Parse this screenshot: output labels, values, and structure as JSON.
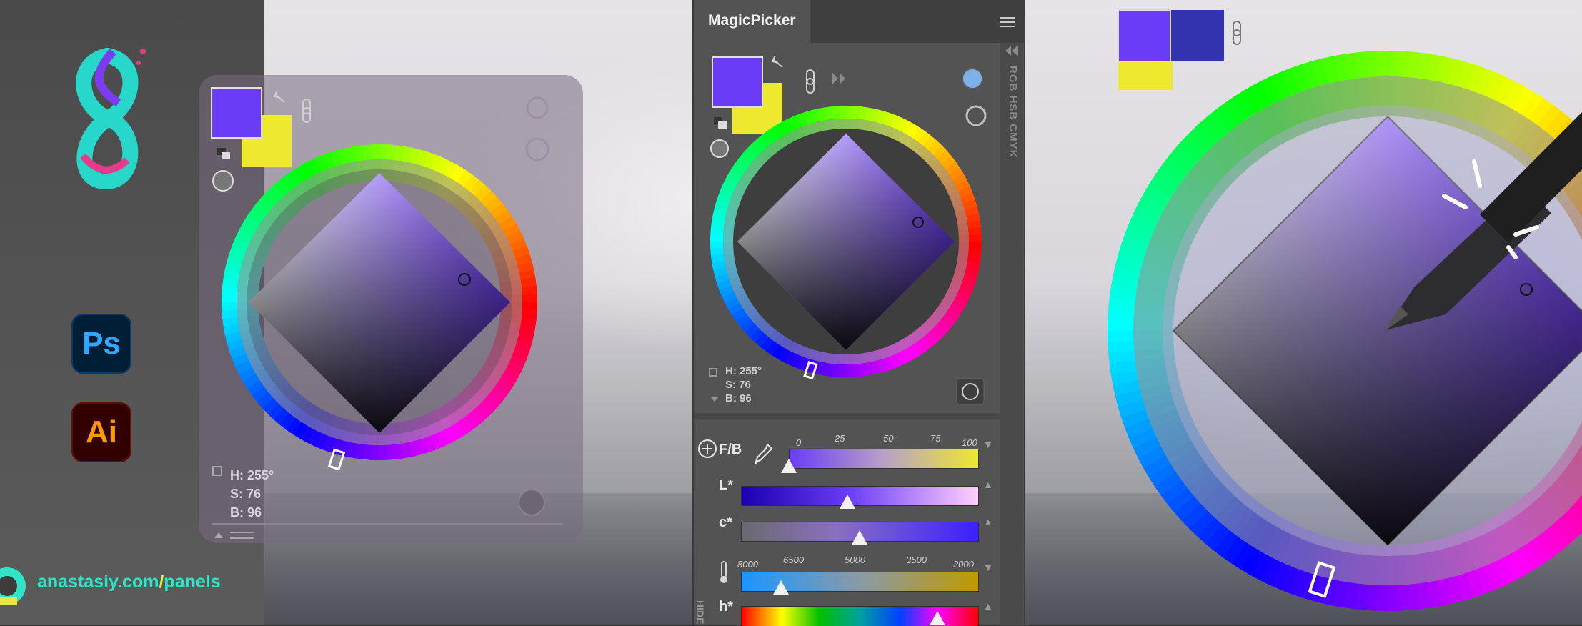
{
  "background": {
    "accent_teal": "#2ee6c7",
    "accent_yellow": "#e8e84a"
  },
  "branding": {
    "logo_icon": "magicpicker-logo-icon",
    "apps": [
      {
        "name": "Photoshop",
        "label": "Ps"
      },
      {
        "name": "Illustrator",
        "label": "Ai"
      }
    ],
    "url_domain": "anastasiy.com",
    "url_slash": "/",
    "url_path": "panels"
  },
  "float_panel": {
    "hsb": {
      "h": "H: 255°",
      "s": "S: 76",
      "b": "B: 96"
    },
    "foreground_color": "#6a3cf5",
    "background_color": "#eee82f"
  },
  "magicpicker": {
    "title": "MagicPicker",
    "menu_icon": "hamburger-menu-icon",
    "side_tabs": "RGB HSB CMYK",
    "hide_label": "HIDE",
    "foreground_color": "#6a3cf5",
    "background_color": "#eee82f",
    "hsb": {
      "h": "H: 255°",
      "s": "S: 76",
      "b": "B: 96"
    },
    "sliders": {
      "fb": {
        "label": "F/B",
        "ticks": [
          "0",
          "25",
          "50",
          "75",
          "100"
        ],
        "value": 0.0
      },
      "l": {
        "label": "L*",
        "value": 0.45
      },
      "c": {
        "label": "c*",
        "value": 0.5
      },
      "temp": {
        "ticks": [
          "8000",
          "6500",
          "5000",
          "3500",
          "2000"
        ],
        "value": 0.17
      },
      "h": {
        "label": "h*",
        "value": 0.83
      }
    }
  },
  "zoom_view": {
    "foreground_color": "#6a3cf5",
    "background_color": "#eee82f",
    "secondary_color": "#3333b0"
  }
}
